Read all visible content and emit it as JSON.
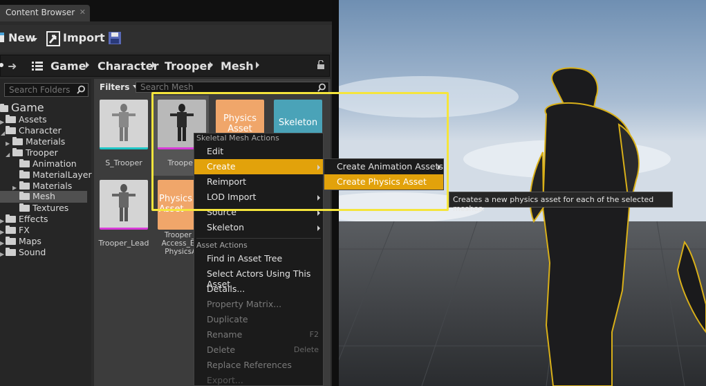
{
  "tab": {
    "title": "Content Browser",
    "close": "✕"
  },
  "toolbar": {
    "new_label": "New",
    "import_label": "Import"
  },
  "path": {
    "items": [
      "Game",
      "Character",
      "Trooper",
      "Mesh"
    ]
  },
  "folders": {
    "search_placeholder": "Search Folders",
    "items": [
      "Game",
      "Assets",
      "Character",
      "Materials",
      "Trooper",
      "Animation",
      "MaterialLayer",
      "Materials",
      "Mesh",
      "Textures",
      "Effects",
      "FX",
      "Maps",
      "Sound"
    ]
  },
  "assets": {
    "filters_label": "Filters",
    "search_placeholder": "Search Mesh",
    "tiles": [
      {
        "label": "S_Trooper"
      },
      {
        "label": "Trooper"
      },
      {
        "label": "Physics Asset",
        "overlay": "Physics Asset"
      },
      {
        "label": "",
        "overlay": "Skeleton"
      },
      {
        "label": "Trooper_Lead"
      },
      {
        "label": "Trooper_N Access_Exp PhysicsAs",
        "overlay": "Physics Asset"
      }
    ]
  },
  "context_menu": {
    "header1": "Skeletal Mesh Actions",
    "items1": [
      "Edit",
      "Create",
      "Reimport",
      "LOD Import",
      "Source",
      "Skeleton"
    ],
    "header2": "Asset Actions",
    "items2": [
      "Find in Asset Tree",
      "Select Actors Using This Asset",
      "Details...",
      "Property Matrix...",
      "Duplicate",
      "Rename",
      "Delete",
      "Replace References",
      "Export..."
    ],
    "shortcuts": {
      "rename": "F2",
      "delete": "Delete"
    }
  },
  "submenu": {
    "items": [
      "Create Animation Assets",
      "Create Physics Asset"
    ]
  },
  "tooltip": {
    "text": "Creates a new physics asset for each of the selected meshes."
  },
  "colors": {
    "selection": "#e2a20b",
    "highlight_box": "#f5e53c",
    "physics_tile": "#f0a66a",
    "skeleton_tile": "#4aa3b8"
  }
}
